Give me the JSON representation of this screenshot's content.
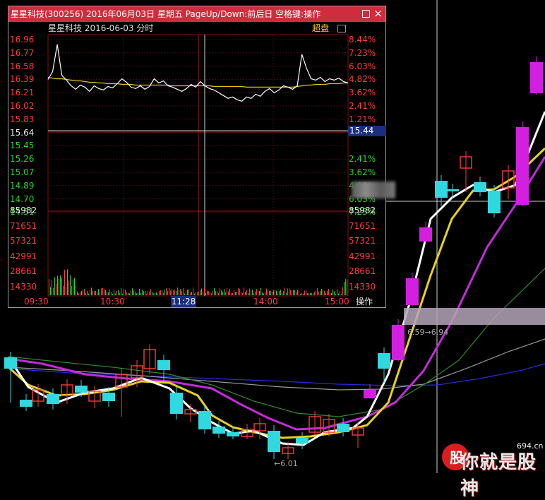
{
  "window": {
    "title": "星星科技(300256) 2016年06月03日 星期五 PageUp/Down:前后日 空格键:操作",
    "close": "×"
  },
  "subhead": {
    "name": "星星科技 2016-06-03 分时",
    "mode": "超盘"
  },
  "left_scale": [
    "16.96",
    "16.77",
    "16.58",
    "16.39",
    "16.21",
    "16.02",
    "15.83",
    "15.64",
    "15.45",
    "15.26",
    "15.07",
    "14.89",
    "14.70",
    "14.51"
  ],
  "right_scale": [
    "8.44%",
    "7.23%",
    "6.03%",
    "4.82%",
    "3.62%",
    "2.41%",
    "1.21%",
    "0.00%",
    "1.21%",
    "2.41%",
    "3.62%",
    "4.82%",
    "6.03%",
    "7.23%"
  ],
  "vol_scale": [
    "85982",
    "71651",
    "57321",
    "42991",
    "28661",
    "14330"
  ],
  "cursor_price": "15.44",
  "time_labels": [
    "09:30",
    "10:30",
    "11:28",
    "14:00",
    "15:00"
  ],
  "operate": "操作",
  "annotations": {
    "hi": "6.59→6.94",
    "lo": "←6.01"
  },
  "watermark": {
    "text": "你就是股神",
    "url": "694.cn"
  },
  "colors": {
    "up": "#ff3b3b",
    "down": "#30d8e0",
    "price_line": "#ffffff",
    "avg_line": "#e6c619",
    "bg": "#000000"
  },
  "chart_data": {
    "type": "line",
    "title": "星星科技 2016-06-03 分时",
    "price_range": [
      14.51,
      16.96
    ],
    "prev_close": 15.64,
    "price_series": [
      16.39,
      16.5,
      16.89,
      16.45,
      16.38,
      16.3,
      16.25,
      16.31,
      16.28,
      16.22,
      16.3,
      16.26,
      16.24,
      16.29,
      16.27,
      16.33,
      16.4,
      16.35,
      16.28,
      16.26,
      16.3,
      16.25,
      16.29,
      16.4,
      16.34,
      16.37,
      16.3,
      16.28,
      16.25,
      16.22,
      16.26,
      16.32,
      16.28,
      16.36,
      16.3,
      16.26,
      16.24,
      16.2,
      16.16,
      16.12,
      16.14,
      16.1,
      16.08,
      16.14,
      16.12,
      16.18,
      16.15,
      16.22,
      16.26,
      16.2,
      16.24,
      16.3,
      16.28,
      16.25,
      16.3,
      16.75,
      16.55,
      16.4,
      16.38,
      16.42,
      16.36,
      16.4,
      16.38,
      16.41,
      16.36,
      16.34
    ],
    "avg_series": [
      16.42,
      16.41,
      16.4,
      16.4,
      16.39,
      16.38,
      16.37,
      16.37,
      16.36,
      16.35,
      16.35,
      16.34,
      16.34,
      16.33,
      16.33,
      16.33,
      16.32,
      16.32,
      16.32,
      16.31,
      16.31,
      16.31,
      16.31,
      16.31,
      16.31,
      16.31,
      16.31,
      16.3,
      16.3,
      16.3,
      16.3,
      16.3,
      16.3,
      16.3,
      16.3,
      16.3,
      16.29,
      16.29,
      16.29,
      16.29,
      16.29,
      16.29,
      16.29,
      16.28,
      16.28,
      16.28,
      16.28,
      16.28,
      16.28,
      16.28,
      16.28,
      16.28,
      16.28,
      16.28,
      16.29,
      16.3,
      16.31,
      16.31,
      16.32,
      16.32,
      16.32,
      16.33,
      16.33,
      16.33,
      16.34,
      16.34
    ],
    "vol_range": [
      0,
      85982
    ]
  }
}
